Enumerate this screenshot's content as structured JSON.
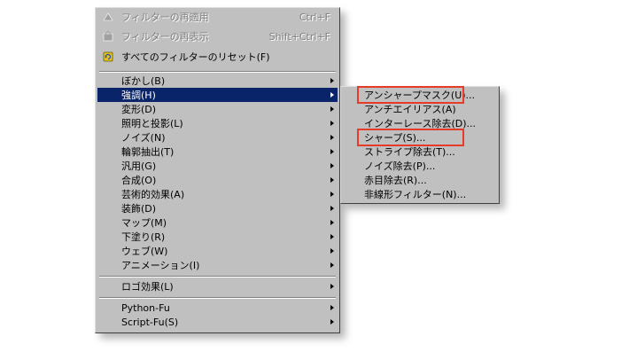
{
  "main_menu": {
    "reapply": {
      "label": "フィルターの再適用",
      "shortcut": "Ctrl+F",
      "icon": "filter-icon"
    },
    "reshow": {
      "label": "フィルターの再表示",
      "shortcut": "Shift+Ctrl+F",
      "icon": "filter-dialog-icon"
    },
    "reset_all": {
      "label": "すべてのフィルターのリセット(F)",
      "icon": "reset-icon"
    },
    "items": [
      {
        "label": "ぼかし(B)"
      },
      {
        "label": "強調(H)",
        "selected": true
      },
      {
        "label": "変形(D)"
      },
      {
        "label": "照明と投影(L)"
      },
      {
        "label": "ノイズ(N)"
      },
      {
        "label": "輪郭抽出(T)"
      },
      {
        "label": "汎用(G)"
      },
      {
        "label": "合成(O)"
      },
      {
        "label": "芸術的効果(A)"
      },
      {
        "label": "装飾(D)"
      },
      {
        "label": "マップ(M)"
      },
      {
        "label": "下塗り(R)"
      },
      {
        "label": "ウェブ(W)"
      },
      {
        "label": "アニメーション(I)"
      }
    ],
    "logo": {
      "label": "ロゴ効果(L)"
    },
    "python": {
      "label": "Python-Fu"
    },
    "script": {
      "label": "Script-Fu(S)"
    }
  },
  "submenu": {
    "items": [
      {
        "label": "アンシャープマスク(U)...",
        "highlighted": true
      },
      {
        "label": "アンチエイリアス(A)"
      },
      {
        "label": "インターレース除去(D)..."
      },
      {
        "label": "シャープ(S)...",
        "highlighted": true
      },
      {
        "label": "ストライプ除去(T)..."
      },
      {
        "label": "ノイズ除去(P)..."
      },
      {
        "label": "赤目除去(R)..."
      },
      {
        "label": "非線形フィルター(N)..."
      }
    ]
  },
  "colors": {
    "menu_bg": "#c0c0c0",
    "selection": "#0a246a",
    "annotation": "#e53b2a"
  }
}
